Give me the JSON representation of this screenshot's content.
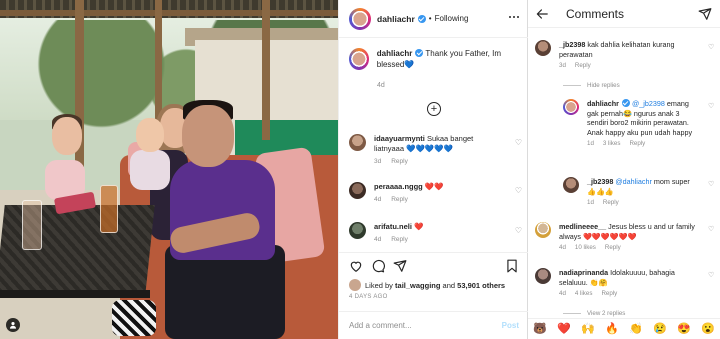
{
  "post": {
    "username": "dahliachr",
    "follow_status": "Following",
    "caption_user": "dahliachr",
    "caption_text": "Thank you Father, Im blessed",
    "caption_emoji": "💙",
    "caption_age": "4d",
    "comments": [
      {
        "user": "idaayuarmynti",
        "text": "Sukaa banget liatnyaaa",
        "emoji": "💙💙💙💙💙",
        "age": "3d",
        "reply": "Reply"
      },
      {
        "user": "peraaaa.nggg",
        "text": "",
        "emoji": "❤️❤️",
        "age": "4d",
        "reply": "Reply"
      },
      {
        "user": "arifatu.neli",
        "text": "",
        "emoji": "❤️",
        "age": "4d",
        "reply": "Reply"
      }
    ],
    "likes_prefix": "Liked by",
    "likes_user": "tail_wagging",
    "likes_and": "and",
    "likes_count": "53,901 others",
    "date": "4 DAYS AGO",
    "add_comment_placeholder": "Add a comment...",
    "post_button": "Post"
  },
  "comments_panel": {
    "title": "Comments",
    "hide_replies": "Hide replies",
    "view_replies": "View 2 replies",
    "items": [
      {
        "user": "_jb2398",
        "text": "kak dahlia kelihatan kurang perawatan",
        "age": "3d",
        "likes": "",
        "reply": "Reply"
      },
      {
        "user": "dahliachr",
        "mention": "@_jb2398",
        "text": "emang gak pernah😂 ngurus anak 3 sendiri boro2 mikirin perawatan. Anak happy aku pun udah happy",
        "age": "1d",
        "likes": "3 likes",
        "reply": "Reply"
      },
      {
        "user": "_jb2398",
        "mention": "@dahliachr",
        "text": "mom super👍👍👍",
        "age": "1d",
        "likes": "",
        "reply": "Reply"
      },
      {
        "user": "medlineeee__",
        "text": "Jesus bless u and ur family always",
        "emoji": "❤️❤️❤️❤️❤️❤️",
        "age": "4d",
        "likes": "10 likes",
        "reply": "Reply"
      },
      {
        "user": "nadiaprinanda",
        "text": "Idolakuuuu, bahagia selaluuu.",
        "emoji": "👏🤗",
        "age": "4d",
        "likes": "4 likes",
        "reply": "Reply"
      }
    ],
    "emojis": [
      "🐻",
      "❤️",
      "🙌",
      "🔥",
      "👏",
      "😢",
      "😍",
      "😮"
    ]
  }
}
